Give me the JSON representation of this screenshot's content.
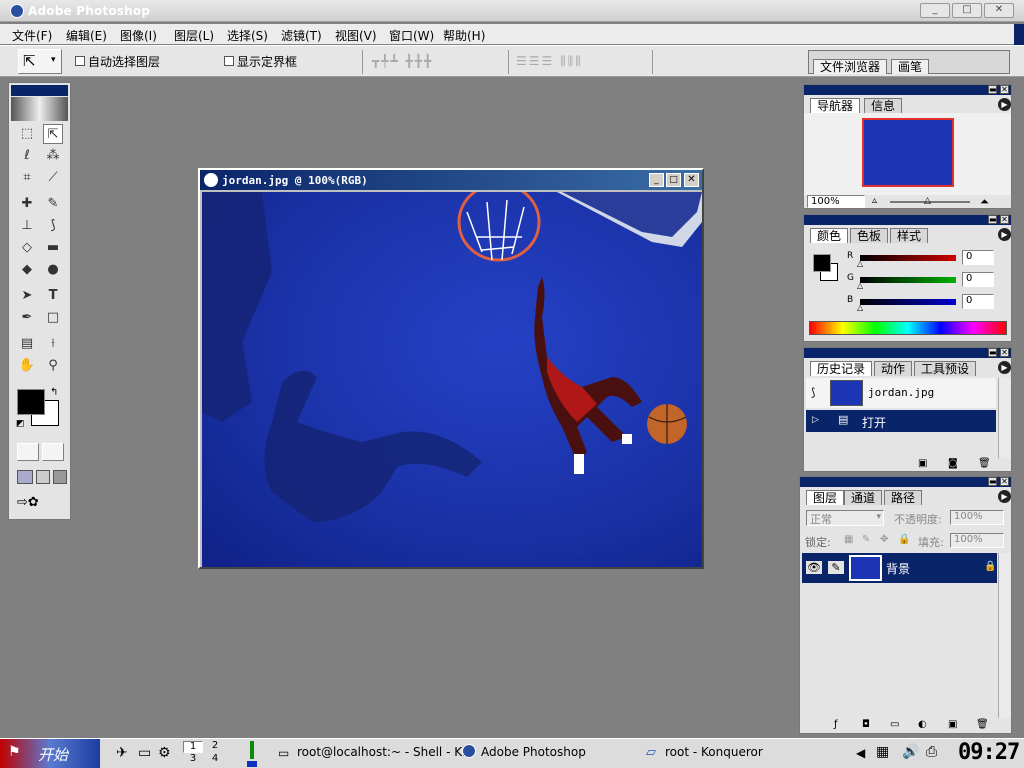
{
  "app": {
    "title": "Adobe Photoshop"
  },
  "menu": [
    "文件(F)",
    "编辑(E)",
    "图像(I)",
    "图层(L)",
    "选择(S)",
    "滤镜(T)",
    "视图(V)",
    "窗口(W)",
    "帮助(H)"
  ],
  "options": {
    "auto_select_label": "自动选择图层",
    "show_bounds_label": "显示定界框",
    "tabs": [
      "文件浏览器",
      "画笔"
    ]
  },
  "document": {
    "title": "jordan.jpg @ 100%(RGB)"
  },
  "navigator": {
    "tabs": [
      "导航器",
      "信息"
    ],
    "zoom": "100%"
  },
  "color_panel": {
    "tabs": [
      "颜色",
      "色板",
      "样式"
    ],
    "channels": [
      {
        "label": "R",
        "value": "0",
        "color": "#d00000"
      },
      {
        "label": "G",
        "value": "0",
        "color": "#00b000"
      },
      {
        "label": "B",
        "value": "0",
        "color": "#0000d0"
      }
    ]
  },
  "history_panel": {
    "tabs": [
      "历史记录",
      "动作",
      "工具预设"
    ],
    "snapshot": "jordan.jpg",
    "states": [
      "打开"
    ]
  },
  "layers_panel": {
    "tabs": [
      "图层",
      "通道",
      "路径"
    ],
    "blend_mode": "正常",
    "opacity_label": "不透明度:",
    "opacity": "100%",
    "lock_label": "锁定:",
    "fill_label": "填充:",
    "fill": "100%",
    "layers": [
      "背景"
    ]
  },
  "taskbar": {
    "start": "开始",
    "desktops": [
      "1",
      "2",
      "3",
      "4"
    ],
    "tasks": [
      "root@localhost:~ - Shell - Ki",
      "Adobe Photoshop",
      "root - Konqueror"
    ],
    "clock": "09:27"
  },
  "colors": {
    "accent": "#0a246a",
    "canvas_bg": "#1a36b8",
    "taskbar_start": "#c00000"
  }
}
